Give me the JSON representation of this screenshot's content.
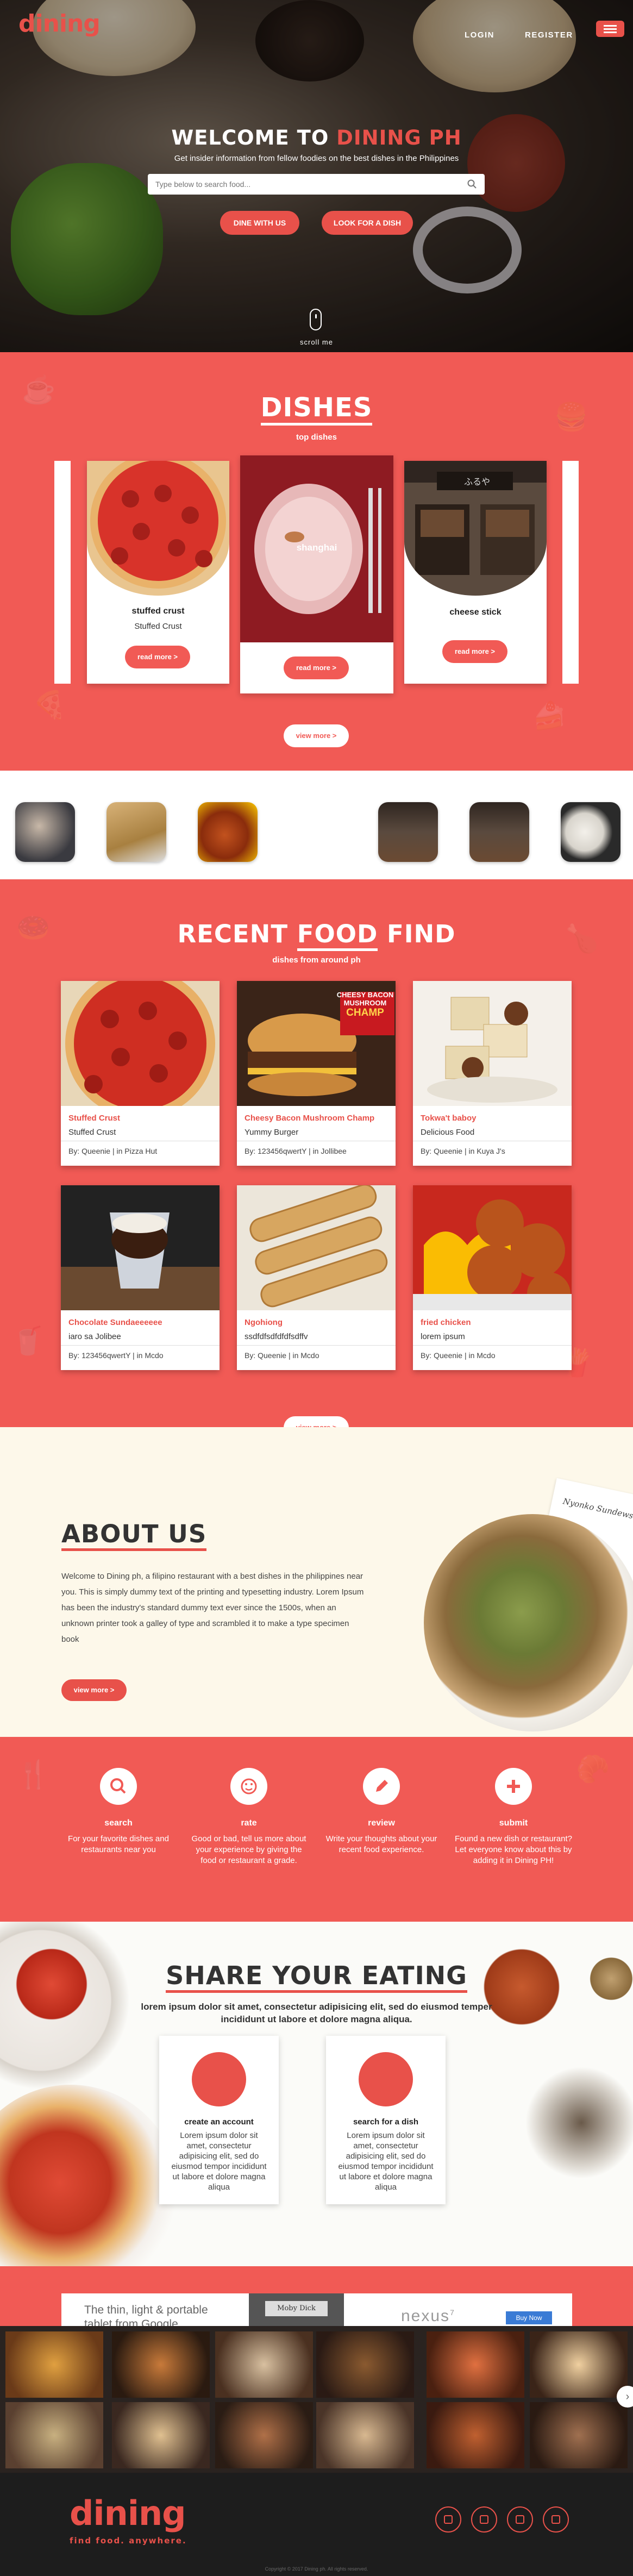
{
  "header": {
    "logo": "dining",
    "nav": [
      {
        "label": "LOGIN"
      },
      {
        "label": "REGISTER"
      }
    ]
  },
  "hero": {
    "title_prefix": "WELCOME TO ",
    "title_accent": "DINING PH",
    "subtitle": "Get insider information from fellow foodies on the best dishes in the Philippines",
    "search_placeholder": "Type below to search food...",
    "buttons": [
      "DINE WITH US",
      "LOOK FOR A DISH"
    ],
    "scroll_label": "scroll me"
  },
  "dishes": {
    "title": "DISHES",
    "subtitle": "top dishes",
    "cards": [
      {
        "name": "stuffed crust",
        "desc": "Stuffed Crust",
        "button": "read more >"
      },
      {
        "name": "shanghai",
        "desc": "",
        "button": "read more >"
      },
      {
        "name": "cheese stick",
        "desc": "",
        "button": "read more >"
      }
    ],
    "view_more": "view more >"
  },
  "recent": {
    "title_prefix": "RECENT ",
    "title_accent": "FOOD",
    "title_suffix": " FIND",
    "subtitle": "dishes from around ph",
    "cards": [
      {
        "name": "Stuffed Crust",
        "sub": "Stuffed Crust",
        "by": "By: Queenie | in Pizza Hut"
      },
      {
        "name": "Cheesy Bacon Mushroom Champ",
        "sub": "Yummy Burger",
        "by": "By: 123456qwertY | in Jollibee"
      },
      {
        "name": "Tokwa't baboy",
        "sub": "Delicious Food",
        "by": "By: Queenie | in Kuya J's"
      },
      {
        "name": "Chocolate Sundaeeeeee",
        "sub": "iaro sa Jolibee",
        "by": "By: 123456qwertY | in Mcdo"
      },
      {
        "name": "Ngohiong",
        "sub": "ssdfdfsdfdfdfsdffv",
        "by": "By: Queenie | in Mcdo"
      },
      {
        "name": "fried chicken",
        "sub": "lorem ipsum",
        "by": "By: Queenie | in Mcdo"
      }
    ],
    "burger_caption_1": "CHEESY BACON",
    "burger_caption_2": "MUSHROOM",
    "burger_caption_3": "CHAMP",
    "view_more": "view more >"
  },
  "about": {
    "title": "ABOUT US",
    "text": "Welcome to Dining ph, a filipino restaurant with a best dishes in the philippines near you. This is simply dummy text of the printing and typesetting industry. Lorem Ipsum has been the industry's standard dummy text ever since the 1500s, when an unknown printer took a galley of type and scrambled it to make a type specimen book",
    "button": "view more >",
    "paper_note": "Nyonko Sundews"
  },
  "features": [
    {
      "title": "search",
      "text": "For your favorite dishes and restaurants near you",
      "icon": "search-icon"
    },
    {
      "title": "rate",
      "text": "Good or bad, tell us more about your experience by giving the food or restaurant a grade.",
      "icon": "smiley-icon"
    },
    {
      "title": "review",
      "text": "Write your thoughts about your recent food experience.",
      "icon": "pencil-icon"
    },
    {
      "title": "submit",
      "text": "Found a new dish or restaurant? Let everyone know about this by adding it in Dining PH!",
      "icon": "plus-icon"
    }
  ],
  "share": {
    "title_prefix": "SHARE ",
    "title_accent": "YOUR",
    "title_suffix": " EATING",
    "subtitle": "lorem ipsum dolor sit amet, consectetur adipisicing elit, sed do eiusmod temper incididunt ut labore et dolore magna aliqua.",
    "cards": [
      {
        "title": "create an account",
        "text": "Lorem ipsum dolor sit amet, consectetur adipisicing elit, sed do eiusmod tempor incididunt ut labore et dolore magna aliqua"
      },
      {
        "title": "search for a dish",
        "text": "Lorem ipsum dolor sit amet, consectetur adipisicing elit, sed do eiusmod tempor incididunt ut labore et dolore magna aliqua"
      }
    ]
  },
  "ad": {
    "line1": "The thin, light & portable",
    "line2": "tablet from Google.",
    "book": "Moby Dick",
    "brand": "nexus",
    "brand_sup": "7",
    "cta": "Buy Now"
  },
  "footer": {
    "logo": "dining",
    "tagline": "find food. anywhere.",
    "copyright": "Copyright © 2017 Dining ph. All rights reserved."
  },
  "colors": {
    "accent": "#f15a55",
    "dark": "#1d1d1d",
    "cream": "#fdf8ea"
  }
}
